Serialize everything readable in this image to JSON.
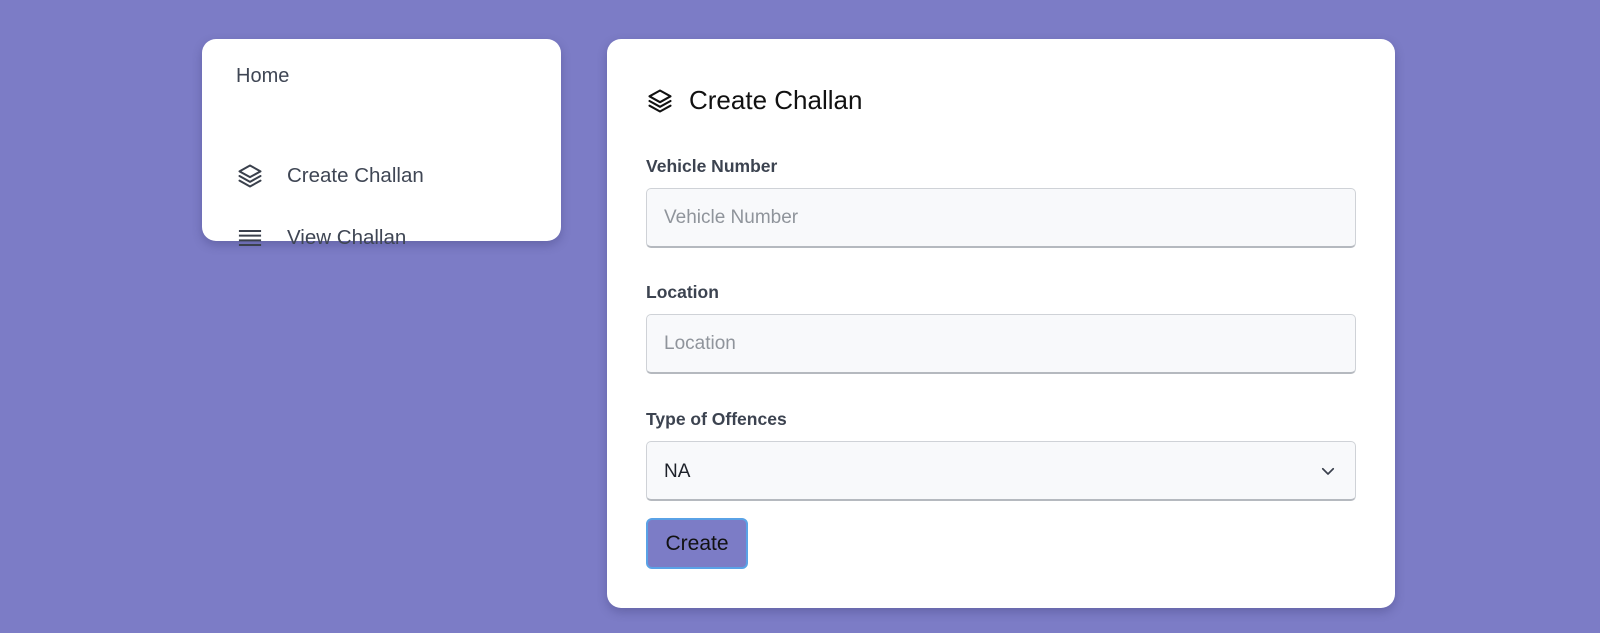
{
  "colors": {
    "background": "#7c7cc6",
    "panel": "#ffffff",
    "button_border": "#5aa2e6"
  },
  "sidebar": {
    "home_label": "Home",
    "items": [
      {
        "label": "Create Challan",
        "icon": "layers-icon"
      },
      {
        "label": "View Challan",
        "icon": "list-icon"
      }
    ]
  },
  "form": {
    "title": "Create Challan",
    "title_icon": "layers-icon",
    "vehicle": {
      "label": "Vehicle Number",
      "placeholder": "Vehicle Number",
      "value": ""
    },
    "location": {
      "label": "Location",
      "placeholder": "Location",
      "value": ""
    },
    "offence": {
      "label": "Type of Offences",
      "selected": "NA"
    },
    "submit_label": "Create"
  }
}
